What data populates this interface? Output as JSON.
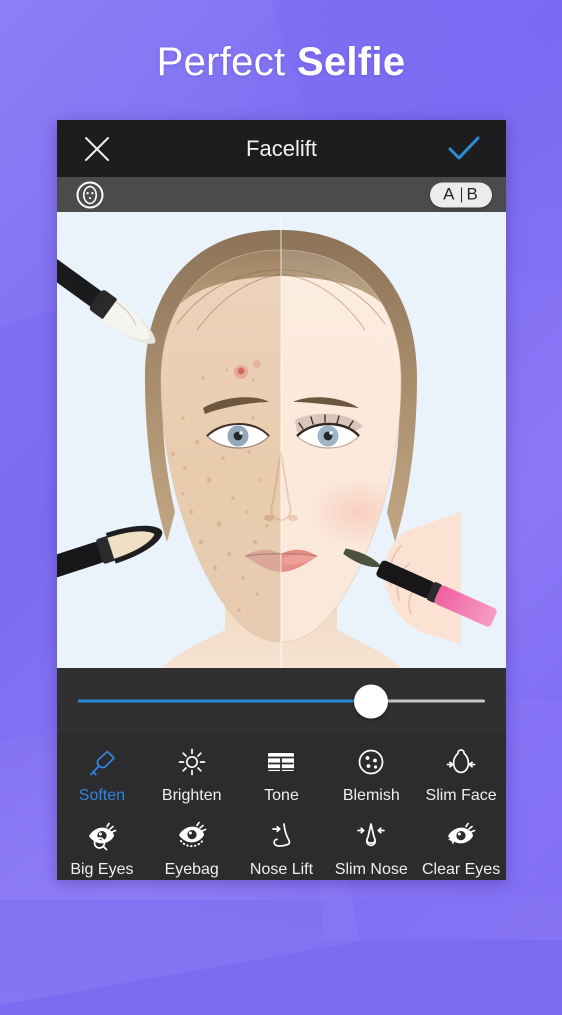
{
  "hero": {
    "title_light": "Perfect ",
    "title_bold": "Selfie"
  },
  "app": {
    "header": {
      "close_icon": "close-x-icon",
      "title": "Facelift",
      "confirm_icon": "checkmark-icon",
      "confirm_color": "#2a8fd8"
    },
    "sub_bar": {
      "face_icon": "face-select-icon",
      "ab_compare": {
        "a": "A",
        "b": "B"
      }
    },
    "photo": {
      "alt": "before-after-split-portrait",
      "background": "#eaf2fb",
      "left_label": "before-blemished-skin",
      "right_label": "after-retouched-skin"
    },
    "slider": {
      "name": "intensity-slider",
      "value_percent": 72,
      "fill_color": "#2a87d8",
      "track_color": "#c9c6c2"
    },
    "tools": {
      "active_color": "#2f85e0",
      "rows": [
        [
          {
            "label": "Soften",
            "icon": "brush-icon",
            "active": true
          },
          {
            "label": "Brighten",
            "icon": "sun-icon",
            "active": false
          },
          {
            "label": "Tone",
            "icon": "grid-panel-icon",
            "active": false
          },
          {
            "label": "Blemish",
            "icon": "dots-circle-icon",
            "active": false
          },
          {
            "label": "Slim Face",
            "icon": "slim-face-icon",
            "active": false
          }
        ],
        [
          {
            "label": "Big Eyes",
            "icon": "eye-magnify-icon",
            "active": false
          },
          {
            "label": "Eyebag",
            "icon": "eye-dotted-icon",
            "active": false
          },
          {
            "label": "Nose Lift",
            "icon": "nose-profile-icon",
            "active": false
          },
          {
            "label": "Slim Nose",
            "icon": "nose-front-icon",
            "active": false
          },
          {
            "label": "Clear Eyes",
            "icon": "eye-sparkle-icon",
            "active": false
          }
        ]
      ]
    }
  }
}
